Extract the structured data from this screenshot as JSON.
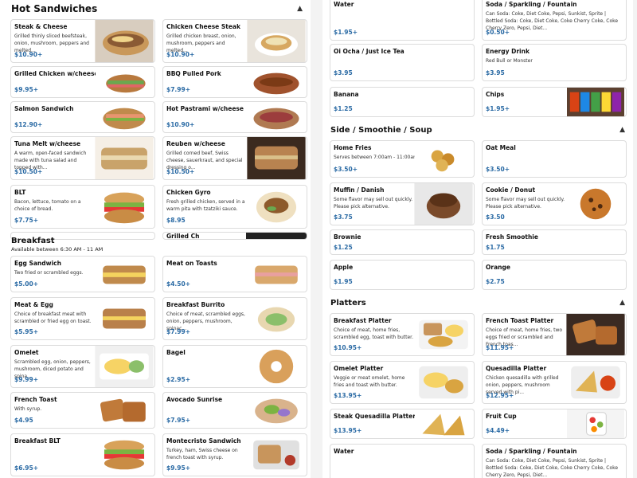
{
  "colors": {
    "price": "#2a6aa4",
    "border": "#dcdcdc",
    "title": "#111111"
  },
  "hot_sandwiches": {
    "title": "Hot Sandwiches",
    "collapse_icon": "chevron-up-icon",
    "items": [
      {
        "name": "Steak & Cheese",
        "desc": "Grilled thinly sliced beefsteak, onion, mushroom, peppers and melted...",
        "price": "$10.90+"
      },
      {
        "name": "Chicken Cheese Steak",
        "desc": "Grilled chicken breast, onion, mushroom, peppers and melted...",
        "price": "$10.90+"
      },
      {
        "name": "Grilled Chicken w/cheese",
        "desc": "",
        "price": "$9.95+"
      },
      {
        "name": "BBQ Pulled Pork",
        "desc": "",
        "price": "$7.99+"
      },
      {
        "name": "Salmon Sandwich",
        "desc": "",
        "price": "$12.90+"
      },
      {
        "name": "Hot Pastrami w/cheese",
        "desc": "",
        "price": "$10.90+"
      },
      {
        "name": "Tuna Melt w/cheese",
        "desc": "A warm, open-faced sandwich made with tuna salad and topped with...",
        "price": "$10.50+"
      },
      {
        "name": "Reuben w/cheese",
        "desc": "Grilled corned beef, Swiss cheese, sauerkraut, and special dressing o...",
        "price": "$10.50+"
      },
      {
        "name": "BLT",
        "desc": "Bacon, lettuce, tomato on a choice of bread.",
        "price": "$7.75+"
      },
      {
        "name": "Chicken Gyro",
        "desc": "Fresh grilled chicken, served in a warm pita with tzatziki sauce.",
        "price": "$8.95"
      }
    ]
  },
  "breakfast": {
    "title": "Breakfast",
    "subtitle": "Available between 6:30 AM - 11 AM",
    "items": [
      {
        "name": "Egg Sandwich",
        "desc": "Two fried or scrambled eggs.",
        "price": "$5.00+"
      },
      {
        "name": "Meat on Toasts",
        "desc": "",
        "price": "$4.50+"
      },
      {
        "name": "Meat & Egg",
        "desc": "Choice of breakfast meat with scrambled or fried egg on toast.",
        "price": "$5.95+"
      },
      {
        "name": "Breakfast Burrito",
        "desc": "Choice of meat, scrambled eggs, onion, peppers, mushroom, spinac...",
        "price": "$7.99+"
      },
      {
        "name": "Omelet",
        "desc": "Scrambled egg, onion, peppers, mushroom, diced potato and spina...",
        "price": "$9.99+"
      },
      {
        "name": "Bagel",
        "desc": "",
        "price": "$2.95+"
      },
      {
        "name": "French Toast",
        "desc": "With syrup.",
        "price": "$4.95"
      },
      {
        "name": "Avocado Sunrise",
        "desc": "",
        "price": "$7.95+"
      },
      {
        "name": "Breakfast BLT",
        "desc": "",
        "price": "$6.95+"
      },
      {
        "name": "Montecristo Sandwich",
        "desc": "Turkey, ham, Swiss cheese on french toast with syrup.",
        "price": "$9.95+"
      }
    ]
  },
  "drinks_top": {
    "items": [
      {
        "name": "Water",
        "desc": "",
        "price": "$1.95+"
      },
      {
        "name": "Soda / Sparkling / Fountain",
        "desc": "Can Soda: Coke, Diet Coke, Pepsi, Sunkist, Sprite | Bottled Soda: Coke, Diet Coke, Coke Cherry Coke, Coke Cherry Zero, Pepsi, Diet...",
        "price": "$0.50+"
      },
      {
        "name": "Oi Ocha / Just Ice Tea",
        "desc": "",
        "price": "$3.95"
      },
      {
        "name": "Energy Drink",
        "desc": "Red Bull or Monster",
        "price": "$3.95"
      },
      {
        "name": "Banana",
        "desc": "",
        "price": "$1.25"
      },
      {
        "name": "Chips",
        "desc": "",
        "price": "$1.95+"
      }
    ]
  },
  "side_smoothie_soup": {
    "title": "Side / Smoothie / Soup",
    "collapse_icon": "chevron-up-icon",
    "items": [
      {
        "name": "Home Fries",
        "desc": "Serves between 7:00am - 11:00am",
        "price": "$3.50+"
      },
      {
        "name": "Oat Meal",
        "desc": "",
        "price": "$3.50+"
      },
      {
        "name": "Muffin / Danish",
        "desc": "Some flavor may sell out quickly. Please pick alternative.",
        "price": "$3.75"
      },
      {
        "name": "Cookie / Donut",
        "desc": "Some flavor may sell out quickly. Please pick alternative.",
        "price": "$3.50"
      },
      {
        "name": "Brownie",
        "desc": "",
        "price": "$1.25"
      },
      {
        "name": "Fresh Smoothie",
        "desc": "",
        "price": "$1.75"
      },
      {
        "name": "Apple",
        "desc": "",
        "price": "$1.95"
      },
      {
        "name": "Orange",
        "desc": "",
        "price": "$2.75"
      }
    ]
  },
  "platters": {
    "title": "Platters",
    "collapse_icon": "chevron-up-icon",
    "items": [
      {
        "name": "Breakfast Platter",
        "desc": "Choice of meat, home fries, scrambled egg, toast with butter.",
        "price": "$10.95+"
      },
      {
        "name": "French Toast Platter",
        "desc": "Choice of meat, home fries, two eggs fried or scrambled and French toas...",
        "price": "$11.95+"
      },
      {
        "name": "Omelet Platter",
        "desc": "Veggie or meat omelet, home fries and toast with butter.",
        "price": "$13.95+"
      },
      {
        "name": "Quesadilla Platter",
        "desc": "Chicken quesadilla with grilled onion, peppers, mushroom served with pi...",
        "price": "$12.95+"
      },
      {
        "name": "Steak Quesadilla Platter",
        "desc": "",
        "price": "$13.95+"
      },
      {
        "name": "Fruit Cup",
        "desc": "",
        "price": "$4.49+"
      },
      {
        "name": "Water",
        "desc": "",
        "price": ""
      },
      {
        "name": "Soda / Sparkling / Fountain",
        "desc": "Can Soda: Coke, Diet Coke, Pepsi, Sunkist, Sprite | Bottled Soda: Coke, Diet Coke, Coke Cherry Coke, Coke Cherry Zero, Pepsi, Diet...",
        "price": ""
      }
    ]
  },
  "partial_items": {
    "grilled_cheese_fragment": "Grilled Ch"
  }
}
